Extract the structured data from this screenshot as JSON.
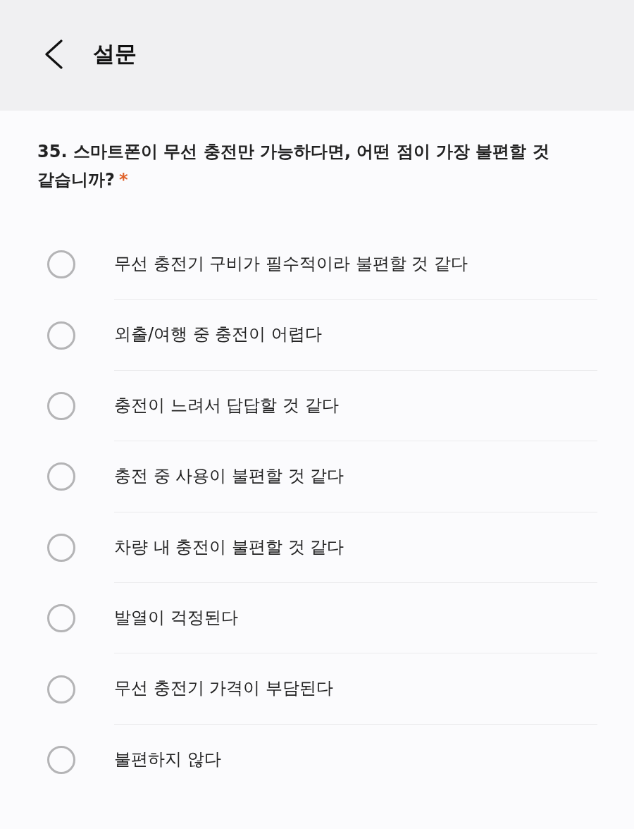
{
  "header": {
    "title": "설문"
  },
  "question": {
    "text": "35. 스마트폰이 무선 충전만 가능하다면, 어떤 점이 가장 불편할 것 같습니까?",
    "required_mark": "*"
  },
  "options": [
    {
      "label": "무선 충전기 구비가 필수적이라 불편할 것 같다",
      "selected": false
    },
    {
      "label": "외출/여행 중 충전이 어렵다",
      "selected": false
    },
    {
      "label": "충전이 느려서 답답할 것 같다",
      "selected": false
    },
    {
      "label": "충전 중 사용이 불편할 것 같다",
      "selected": false
    },
    {
      "label": "차량 내 충전이 불편할 것 같다",
      "selected": false
    },
    {
      "label": "발열이 걱정된다",
      "selected": false
    },
    {
      "label": "무선 충전기 가격이 부담된다",
      "selected": false
    },
    {
      "label": "불편하지 않다",
      "selected": false
    }
  ]
}
